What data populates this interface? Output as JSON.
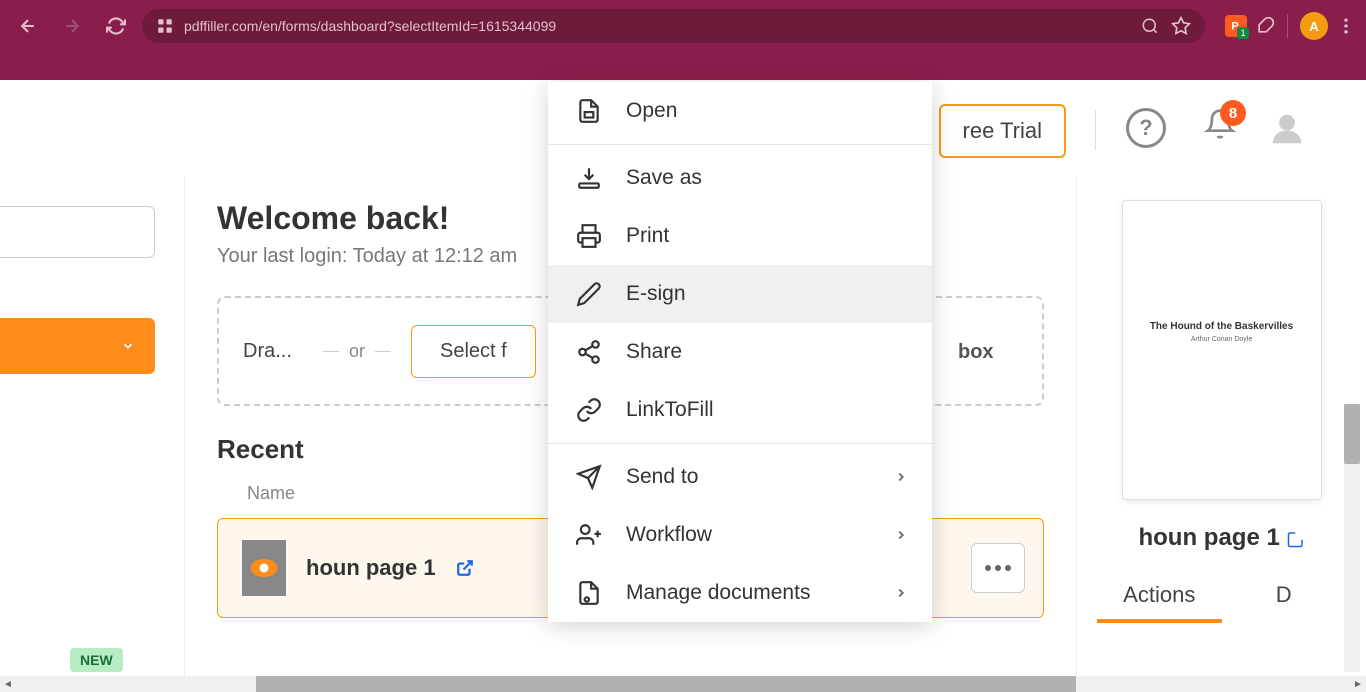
{
  "browser": {
    "url": "pdffiller.com/en/forms/dashboard?selectItemId=1615344099",
    "ext_count": "1",
    "profile_letter": "A"
  },
  "header": {
    "trial_label": "ree Trial",
    "notif_count": "8"
  },
  "sidebar": {
    "new_badge": "NEW"
  },
  "main": {
    "welcome": "Welcome back!",
    "last_login": "Your last login: Today at 12:12 am",
    "drop_text": "Dra...",
    "or_text": "or",
    "select_btn": "Select f",
    "recent_title": "Recent",
    "name_header": "Name",
    "doc_name": "houn page 1"
  },
  "preview": {
    "title": "The Hound of the Baskervilles",
    "author": "Arthur Conan Doyle",
    "doc_title": "houn page 1",
    "tab_actions": "Actions",
    "tab_details": "D"
  },
  "menu": {
    "open": "Open",
    "save_as": "Save as",
    "print": "Print",
    "esign": "E-sign",
    "share": "Share",
    "linktofill": "LinkToFill",
    "send_to": "Send to",
    "workflow": "Workflow",
    "manage_docs": "Manage documents"
  }
}
